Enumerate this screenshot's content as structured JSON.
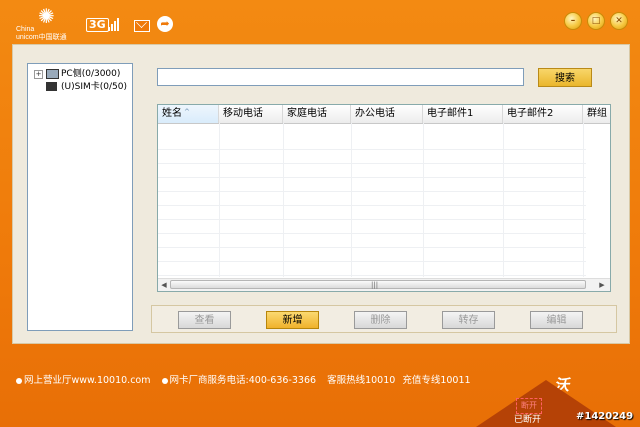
{
  "brand": {
    "logo_line1": "China",
    "logo_line2": "unicom中国联通"
  },
  "header": {
    "badge_3g": "3G",
    "sync_glyph": "➦"
  },
  "window_buttons": {
    "minimize": "–",
    "restore": "□",
    "close": "✕"
  },
  "tree": {
    "expander": "+",
    "items": [
      {
        "label": "PC侧(0/3000)",
        "icon": "computer-icon"
      },
      {
        "label": "(U)SIM卡(0/50)",
        "icon": "sim-card-icon"
      }
    ]
  },
  "search": {
    "value": "",
    "button_label": "搜索"
  },
  "table": {
    "columns": [
      "姓名",
      "移动电话",
      "家庭电话",
      "办公电话",
      "电子邮件1",
      "电子邮件2",
      "群组"
    ],
    "sorted_column": "姓名",
    "sort_direction": "ascending",
    "rows": []
  },
  "scrollbar": {
    "left_arrow": "◀",
    "right_arrow": "▶",
    "grip": "|||"
  },
  "actions": [
    {
      "label": "查看",
      "enabled": false
    },
    {
      "label": "新增",
      "enabled": true
    },
    {
      "label": "删除",
      "enabled": false
    },
    {
      "label": "转存",
      "enabled": false
    },
    {
      "label": "编辑",
      "enabled": false
    }
  ],
  "footer": {
    "items": [
      "网上营业厅www.10010.com",
      "网卡厂商服务电话:400-636-3366",
      "客服热线10010",
      "充值专线10011"
    ],
    "logo": "沃"
  },
  "status": {
    "connection_glyph": "断开",
    "connection": "已断开"
  },
  "watermark": "#1420249",
  "colors": {
    "background": "#ef7a0a",
    "panel": "#efeadd",
    "primary_button": "#f0b22c",
    "status_area": "#b54206"
  }
}
